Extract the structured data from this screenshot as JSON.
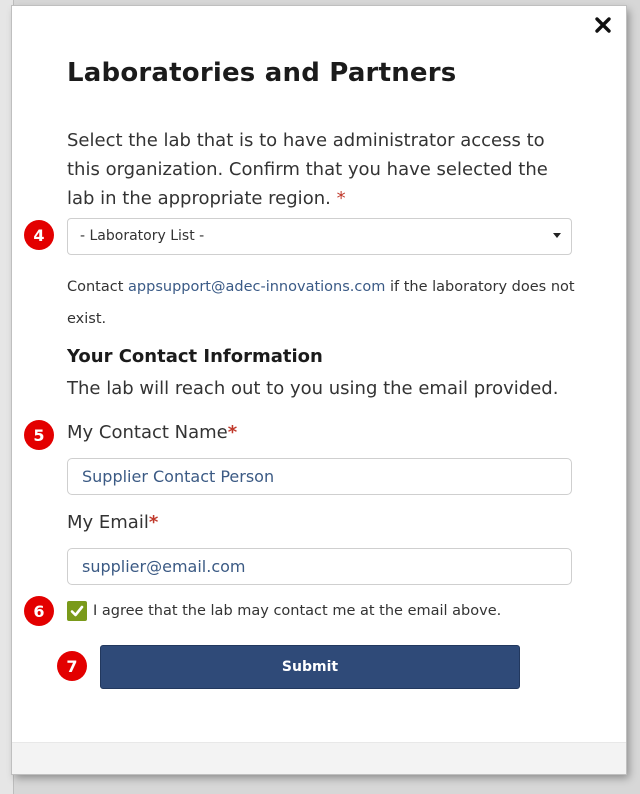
{
  "modal": {
    "title": "Laboratories and Partners",
    "intro": "Select the lab that is to have administrator access to this organization. Confirm that you have selected the lab in the appropriate region.",
    "required_mark": "*",
    "close_icon": "close-icon"
  },
  "lab_select": {
    "selected": "- Laboratory List -"
  },
  "contact_note": {
    "prefix": "Contact",
    "email": "appsupport@adec-innovations.com",
    "suffix": "if the laboratory does not exist."
  },
  "contact_section": {
    "title": "Your Contact Information",
    "description": "The lab will reach out to you using the email provided.",
    "name_label": "My Contact Name",
    "name_value": "Supplier Contact Person",
    "email_label": "My Email",
    "email_value": "supplier@email.com",
    "agree_label": "I agree that the lab may contact me at the email above.",
    "agree_checked": true
  },
  "submit_label": "Submit",
  "markers": [
    "4",
    "5",
    "6",
    "7"
  ],
  "colors": {
    "primary_button": "#2f4a78",
    "checkbox": "#7a9a1a",
    "marker": "#e30000",
    "link": "#3a5a86"
  }
}
